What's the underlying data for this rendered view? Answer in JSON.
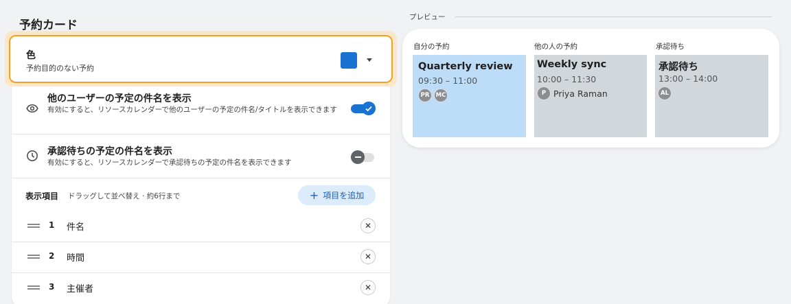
{
  "section_title": "予約カード",
  "color_setting": {
    "title": "色",
    "subtitle": "予約目的のない予約",
    "swatch_color": "#1a73d2"
  },
  "settings": [
    {
      "icon": "eye-icon",
      "title": "他のユーザーの予定の件名を表示",
      "subtitle": "有効にすると、リソースカレンダーで他のユーザーの予定の件名/タイトルを表示できます",
      "enabled": true
    },
    {
      "icon": "clock-icon",
      "title": "承認待ちの予定の件名を表示",
      "subtitle": "有効にすると、リソースカレンダーで承認待ちの予定の件名を表示できます",
      "enabled": false
    }
  ],
  "display_fields": {
    "label": "表示項目",
    "hint": "ドラッグして並べ替え · 約6行まで",
    "add_button": "項目を追加",
    "items": [
      {
        "num": "1",
        "name": "件名",
        "remove": "✕"
      },
      {
        "num": "2",
        "name": "時間",
        "remove": "✕"
      },
      {
        "num": "3",
        "name": "主催者",
        "remove": "✕"
      }
    ]
  },
  "preview": {
    "label": "プレビュー",
    "columns": [
      {
        "header": "自分の予約",
        "title": "Quarterly review",
        "time": "09:30 – 11:00",
        "avatars": [
          "PR",
          "MC"
        ],
        "organizer": "",
        "bg": "#bcdcf7"
      },
      {
        "header": "他の人の予約",
        "title": "Weekly sync",
        "time": "10:00 – 11:30",
        "avatars": [
          "P"
        ],
        "organizer": "Priya Raman",
        "bg": "#d2d7dc"
      },
      {
        "header": "承認待ち",
        "title": "承認待ち",
        "time": "13:00 – 14:00",
        "avatars": [
          "AL"
        ],
        "organizer": "",
        "bg": "#d2d7dc"
      }
    ]
  },
  "colors": {
    "accent": "#1a73d2",
    "focus_border": "#f0a12b"
  }
}
